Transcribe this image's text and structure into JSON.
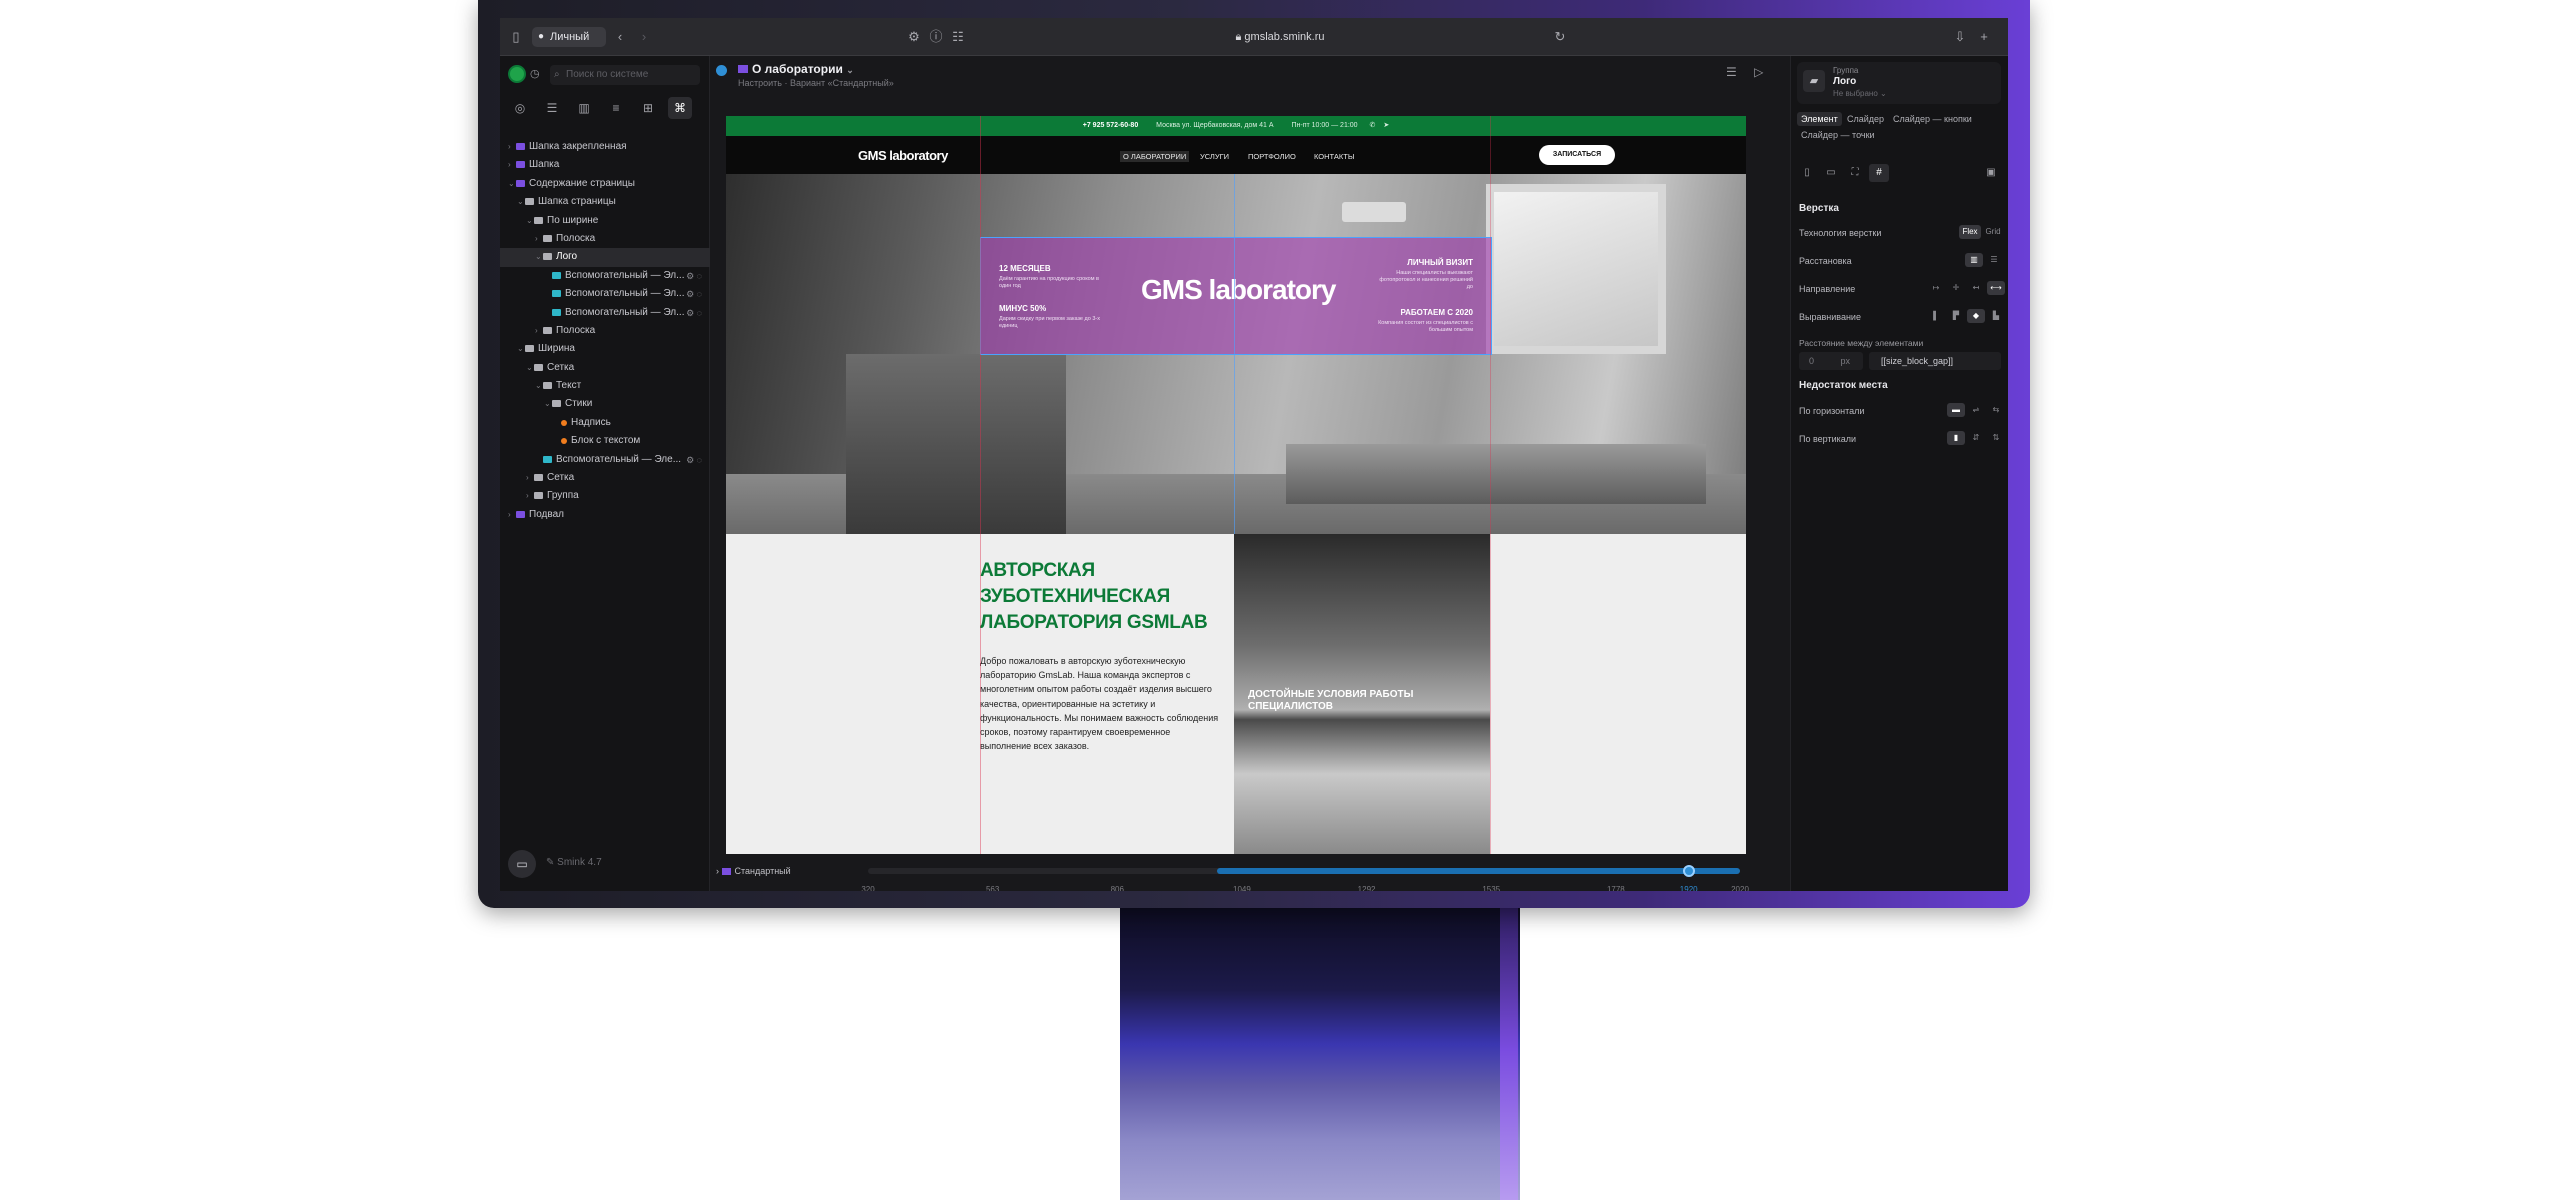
{
  "browser": {
    "profile": "Личный",
    "url": "gmslab.smink.ru"
  },
  "left": {
    "search_placeholder": "Поиск по системе",
    "tree": [
      {
        "label": "Шапка закрепленная",
        "depth": 0,
        "type": "page",
        "caret": "›"
      },
      {
        "label": "Шапка",
        "depth": 0,
        "type": "page",
        "caret": "›"
      },
      {
        "label": "Содержание страницы",
        "depth": 0,
        "type": "page",
        "caret": "⌄"
      },
      {
        "label": "Шапка страницы",
        "depth": 1,
        "type": "folder",
        "caret": "⌄"
      },
      {
        "label": "По ширине",
        "depth": 2,
        "type": "folder",
        "caret": "⌄"
      },
      {
        "label": "Полоска",
        "depth": 3,
        "type": "folder",
        "caret": "›"
      },
      {
        "label": "Лого",
        "depth": 3,
        "type": "folder",
        "caret": "⌄",
        "selected": true
      },
      {
        "label": "Вспомогательный — Эл...",
        "depth": 4,
        "type": "comp",
        "caret": ""
      },
      {
        "label": "Вспомогательный — Эл...",
        "depth": 4,
        "type": "comp",
        "caret": ""
      },
      {
        "label": "Вспомогательный — Эл...",
        "depth": 4,
        "type": "comp",
        "caret": ""
      },
      {
        "label": "Полоска",
        "depth": 3,
        "type": "folder",
        "caret": "›"
      },
      {
        "label": "Ширина",
        "depth": 1,
        "type": "folder",
        "caret": "⌄"
      },
      {
        "label": "Сетка",
        "depth": 2,
        "type": "folder",
        "caret": "⌄"
      },
      {
        "label": "Текст",
        "depth": 3,
        "type": "folder",
        "caret": "⌄"
      },
      {
        "label": "Стики",
        "depth": 4,
        "type": "folder",
        "caret": "⌄"
      },
      {
        "label": "Надпись",
        "depth": 5,
        "type": "dot",
        "caret": ""
      },
      {
        "label": "Блок с текстом",
        "depth": 5,
        "type": "dot",
        "caret": ""
      },
      {
        "label": "Вспомогательный — Эле...",
        "depth": 3,
        "type": "comp",
        "caret": ""
      },
      {
        "label": "Сетка",
        "depth": 2,
        "type": "folder",
        "caret": "›"
      },
      {
        "label": "Группа",
        "depth": 2,
        "type": "folder",
        "caret": "›"
      },
      {
        "label": "Подвал",
        "depth": 0,
        "type": "page",
        "caret": "›"
      }
    ],
    "version": "Smink 4.7"
  },
  "center": {
    "page_title": "О лаборатории",
    "page_sub": "Настроить · Вариант «Стандартный»",
    "variant": "Стандартный",
    "ruler_ticks": [
      320,
      563,
      806,
      1049,
      1292,
      1535,
      1778,
      1920,
      2020
    ],
    "ruler_min": 320,
    "ruler_max": 2020,
    "range_start": 1000,
    "range_end": 2020,
    "current_width": 1920
  },
  "site": {
    "phone": "+7 925 572-60-80",
    "address": "Москва ул. Щербаковская, дом 41 А",
    "hours": "Пн-пт 10:00 — 21:00",
    "logo": "GMS laboratory",
    "nav": [
      "О ЛАБОРАТОРИИ",
      "УСЛУГИ",
      "ПОРТФОЛИО",
      "КОНТАКТЫ"
    ],
    "cta": "ЗАПИСАТЬСЯ",
    "hero_logo": "GMS laboratory",
    "badges": {
      "b1_title": "12 МЕСЯЦЕВ",
      "b1_text": "Даём гарантию на продукцию сроком в один год",
      "b2_title": "МИНУС 50%",
      "b2_text": "Дарим скидку при первом заказе до 3-х единиц",
      "b3_title": "ЛИЧНЫЙ ВИЗИТ",
      "b3_text": "Наши специалисты выезжают фотопротокол и нанесения решений до",
      "b4_title": "РАБОТАЕМ С 2020",
      "b4_text": "Компания состоит из специалистов с большим опытом"
    },
    "about_title": "АВТОРСКАЯ ЗУБОТЕХНИЧЕСКАЯ ЛАБОРАТОРИЯ GSMLAB",
    "about_text": "Добро пожаловать в авторскую зуботехническую лабораторию GmsLab. Наша команда экспертов с многолетним опытом работы создаёт изделия высшего качества, ориентированные на эстетику и функциональность. Мы понимаем важность соблюдения сроков, поэтому гарантируем своевременное выполнение всех заказов.",
    "photo_caption": "ДОСТОЙНЫЕ УСЛОВИЯ РАБОТЫ СПЕЦИАЛИСТОВ"
  },
  "right": {
    "group_label": "Группа",
    "group_name": "Лого",
    "group_state": "Не выбрано",
    "tabs": [
      "Элемент",
      "Слайдер",
      "Слайдер — кнопки",
      "Слайдер — точки"
    ],
    "layout_section": "Верстка",
    "tech_label": "Технология верстки",
    "tech_flex": "Flex",
    "tech_grid": "Grid",
    "arrangement_label": "Расстановка",
    "direction_label": "Направление",
    "align_label": "Выравнивание",
    "gap_label": "Расстояние между элементами",
    "gap_value": "0",
    "gap_unit": "px",
    "gap_var": "[[size_block_gap]]",
    "lack_section": "Недостаток места",
    "horizontal_label": "По горизонтали",
    "vertical_label": "По вертикали"
  },
  "colors": {
    "accent": "#2f8fd6",
    "brand_green": "#0c7a37",
    "selection": "#a03caf",
    "page_icon": "#7b4fe0"
  }
}
